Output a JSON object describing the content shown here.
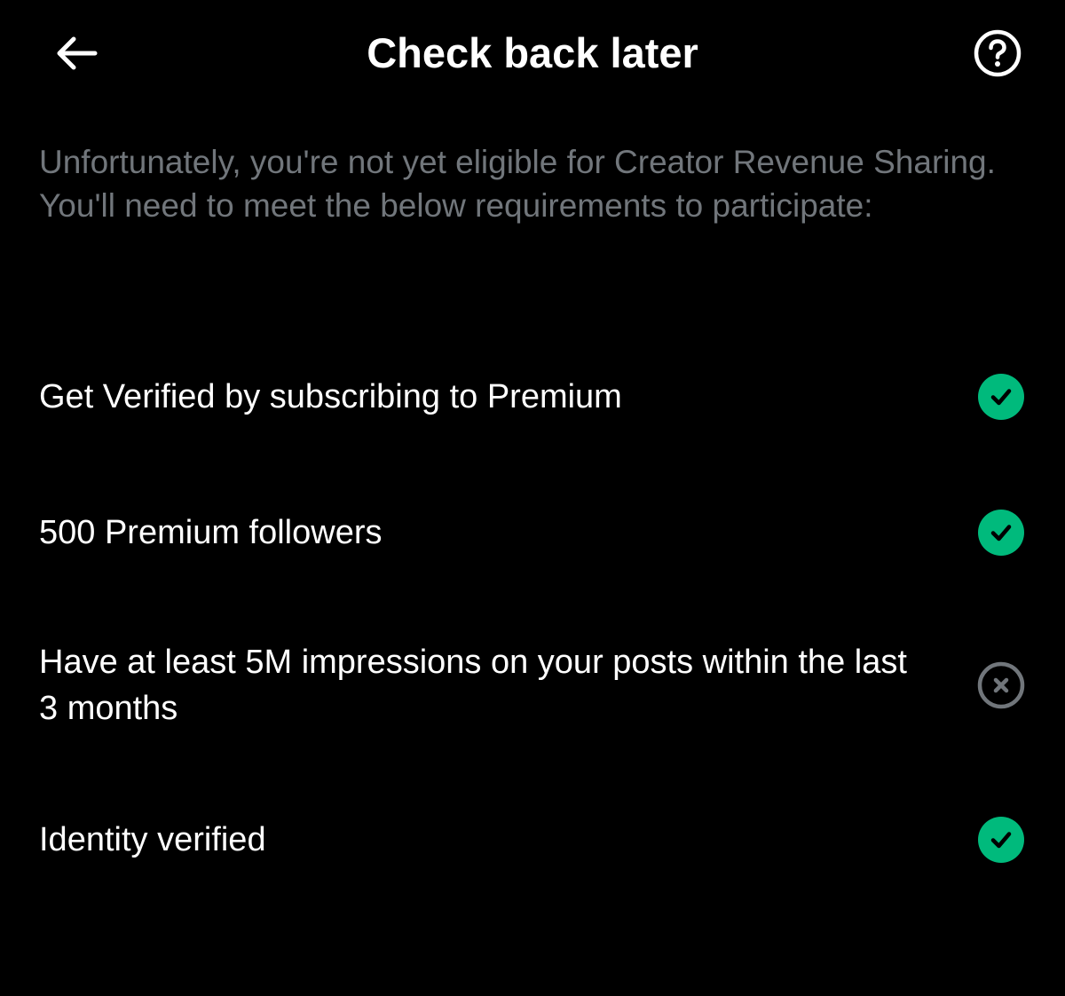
{
  "header": {
    "title": "Check back later",
    "back_icon": "arrow-left-icon",
    "help_icon": "question-circle-icon"
  },
  "intro": {
    "text": "Unfortunately, you're not yet eligible for Creator Revenue Sharing. You'll need to meet the below requirements to participate:"
  },
  "requirements": [
    {
      "label": "Get Verified by subscribing to Premium",
      "status": "met",
      "icon": "check-circle-icon"
    },
    {
      "label": "500 Premium followers",
      "status": "met",
      "icon": "check-circle-icon"
    },
    {
      "label": "Have at least 5M impressions on your posts within the last 3 months",
      "status": "not-met",
      "icon": "x-circle-icon"
    },
    {
      "label": "Identity verified",
      "status": "met",
      "icon": "check-circle-icon"
    }
  ],
  "colors": {
    "background": "#000000",
    "title": "#ffffff",
    "intro_text": "#71767b",
    "met": "#00ba7c",
    "not_met": "#71767b"
  }
}
